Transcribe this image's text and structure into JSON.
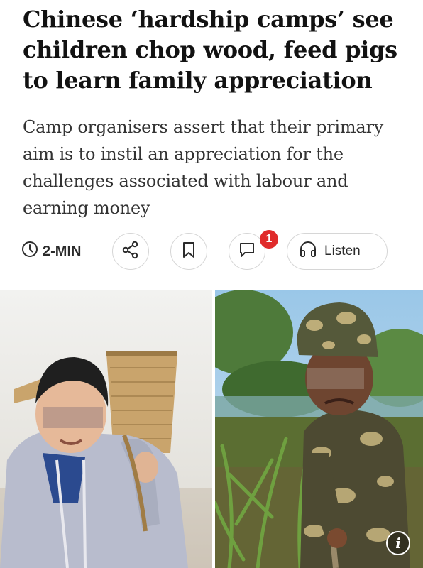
{
  "article": {
    "headline": "Chinese ‘hardship camps’ see children chop wood, feed pigs to learn family appreciation",
    "standfirst": "Camp organisers assert that their primary aim is to instil an appreciation for the challenges associated with labour and earning money"
  },
  "toolbar": {
    "read_time": "2-MIN",
    "comment_count": "1",
    "listen_label": "Listen",
    "icons": [
      "clock-icon",
      "share-icon",
      "bookmark-icon",
      "comment-icon",
      "headphones-icon"
    ]
  },
  "photos": {
    "info_glyph": "i"
  },
  "colors": {
    "badge": "#e02b2b",
    "border": "#d6d6d6",
    "headline": "#121212"
  }
}
